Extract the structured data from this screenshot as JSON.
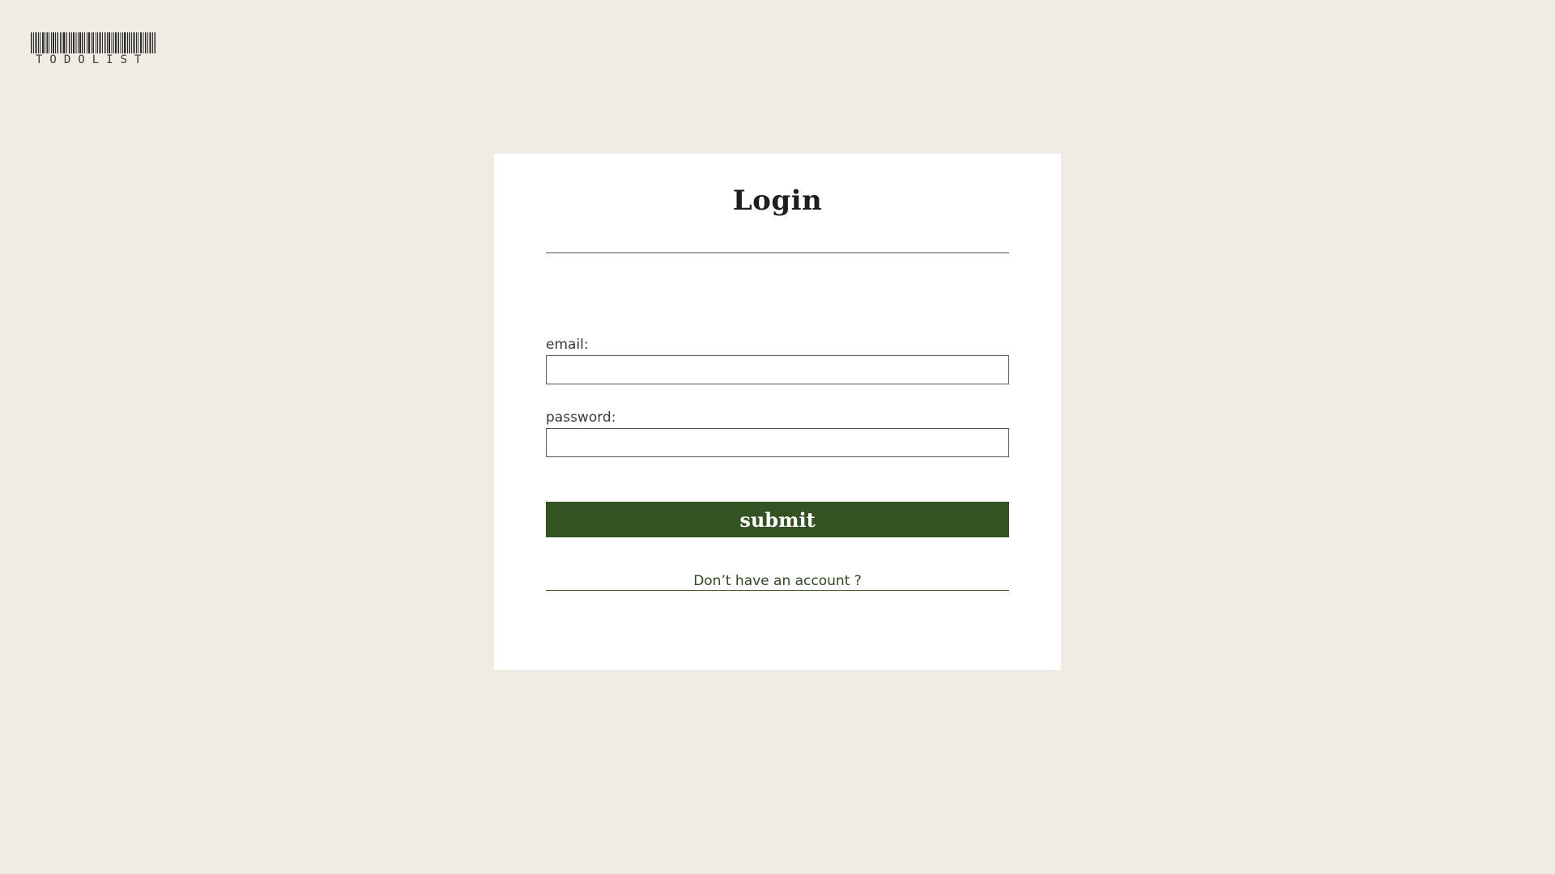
{
  "logo": {
    "text": "TODOLIST"
  },
  "login": {
    "title": "Login",
    "email_label": "email:",
    "email_value": "",
    "password_label": "password:",
    "password_value": "",
    "submit_label": "submit",
    "signup_link": "Don’t have an account ?"
  },
  "colors": {
    "background": "#efece3",
    "card": "#ffffff",
    "accent": "#345322",
    "link": "#2f4a20"
  }
}
